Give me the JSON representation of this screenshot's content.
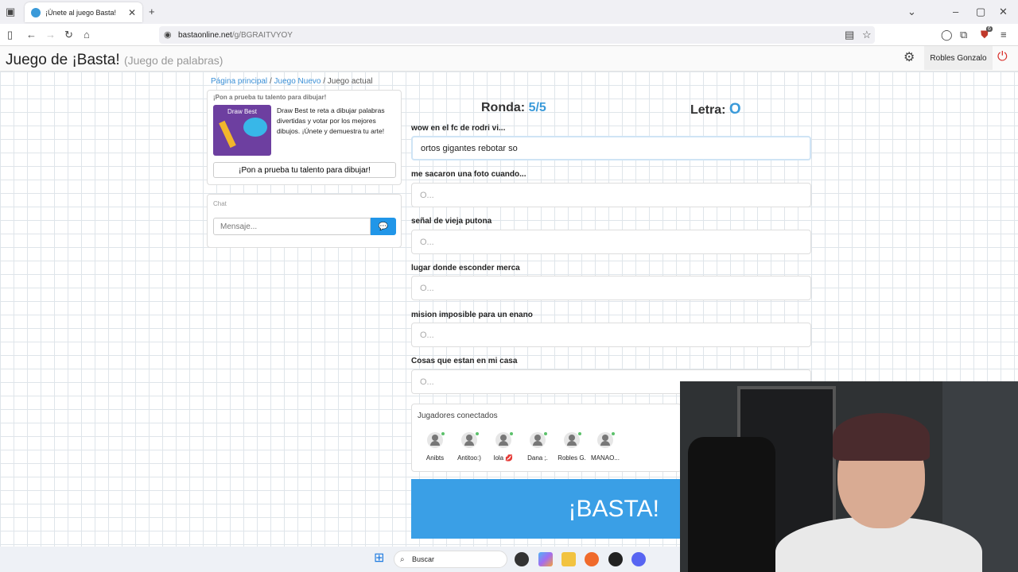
{
  "browser": {
    "tab_title": "¡Únete al juego Basta!",
    "url_host": "bastaonline.net",
    "url_path": "/g/BGRAITVYOY",
    "extension_badge": "6"
  },
  "header": {
    "title": "Juego de ¡Basta!",
    "subtitle": "(Juego de palabras)",
    "user_name": "Robles Gonzalo"
  },
  "breadcrumb": {
    "home": "Página principal",
    "new_game": "Juego Nuevo",
    "current": "Juego actual"
  },
  "promo": {
    "heading": "¡Pon a prueba tu talento para dibujar!",
    "image_label": "Draw Best",
    "text": "Draw Best te reta a dibujar palabras divertidas y votar por los mejores dibujos. ¡Únete y demuestra tu arte!",
    "button": "¡Pon a prueba tu talento para dibujar!"
  },
  "chat": {
    "label": "Chat",
    "placeholder": "Mensaje..."
  },
  "game": {
    "round_label": "Ronda:",
    "round_value": "5/5",
    "letter_label": "Letra:",
    "letter_value": "O",
    "categories": [
      {
        "label": "wow en el fc de rodri vi...",
        "value": "ortos gigantes rebotar so",
        "placeholder": "O..."
      },
      {
        "label": "me sacaron una foto cuando...",
        "value": "",
        "placeholder": "O..."
      },
      {
        "label": "señal de vieja putona",
        "value": "",
        "placeholder": "O..."
      },
      {
        "label": "lugar donde esconder merca",
        "value": "",
        "placeholder": "O..."
      },
      {
        "label": "mision imposible para un enano",
        "value": "",
        "placeholder": "O..."
      },
      {
        "label": "Cosas que estan en mi casa",
        "value": "",
        "placeholder": "O..."
      }
    ],
    "players_title": "Jugadores conectados",
    "players": [
      "Anibts",
      "Antitoo:)",
      "lola 💋",
      "Dana ;.",
      "Robles G.",
      "MANAO..."
    ],
    "basta_button": "¡BASTA!"
  },
  "taskbar": {
    "search_placeholder": "Buscar"
  },
  "colors": {
    "accent": "#3a9fe6",
    "online": "#5cc16b"
  }
}
